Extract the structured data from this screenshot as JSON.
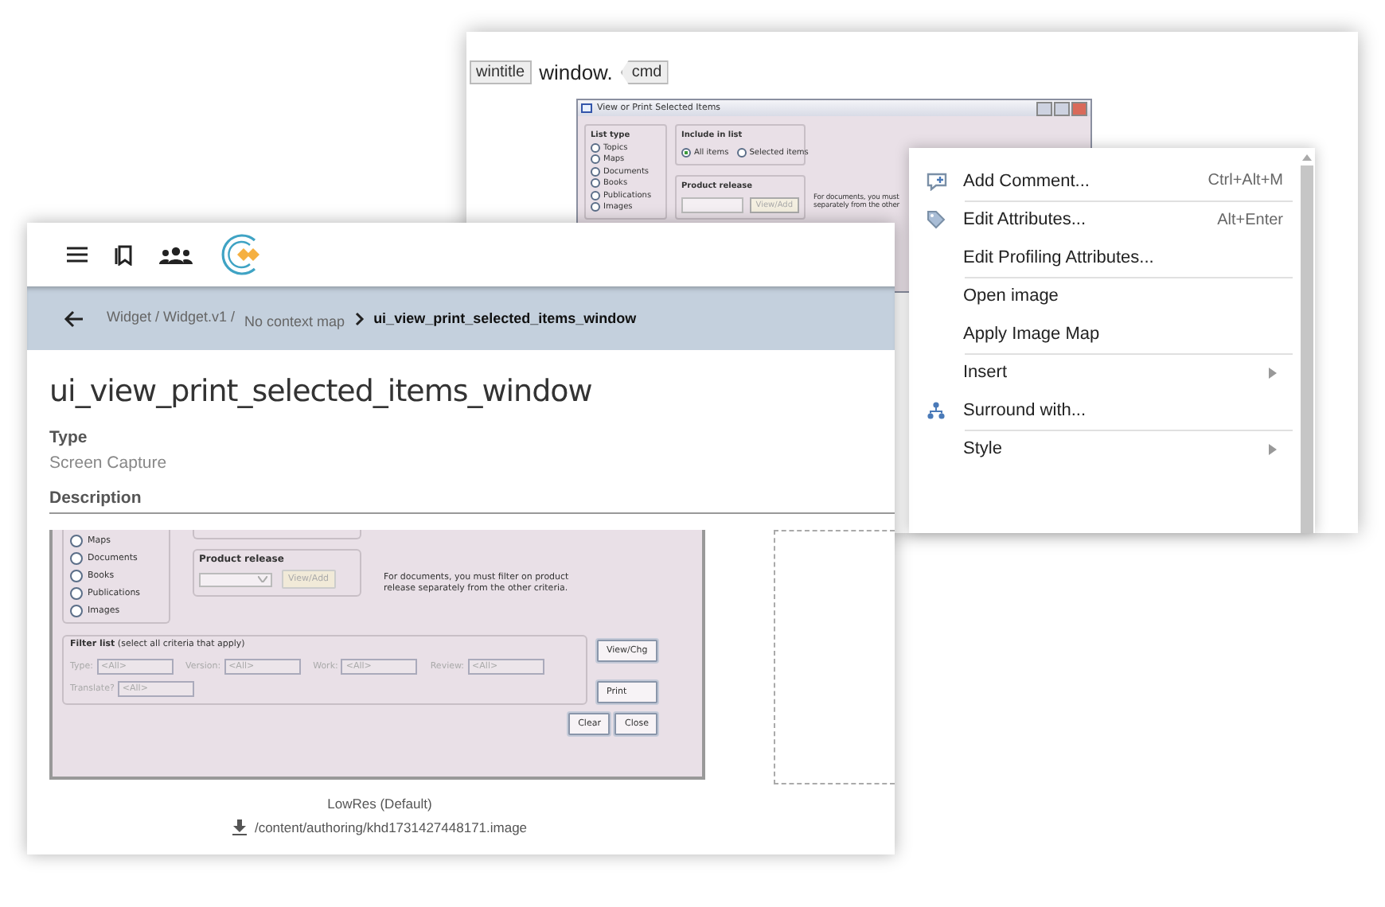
{
  "back_panel": {
    "tag_line": [
      {
        "kind": "tag",
        "text": "wintitle"
      },
      {
        "kind": "word",
        "text": "window."
      },
      {
        "kind": "cmd",
        "text": "cmd"
      }
    ],
    "dialog": {
      "title": "View or Print Selected Items",
      "list_type": {
        "label": "List type",
        "options": [
          {
            "label": "Topics",
            "selected": false
          },
          {
            "label": "Maps",
            "selected": false
          },
          {
            "label": "Documents",
            "selected": false
          },
          {
            "label": "Books",
            "selected": false
          },
          {
            "label": "Publications",
            "selected": false
          },
          {
            "label": "Images",
            "selected": false
          }
        ]
      },
      "include": {
        "label": "Include in list",
        "options": [
          {
            "label": "All items",
            "selected": true
          },
          {
            "label": "Selected items",
            "selected": false
          }
        ]
      },
      "product_release": {
        "label": "Product release",
        "button": {
          "label": "View/Add",
          "disabled": true
        }
      },
      "note": [
        "For documents, you must",
        "separately from the other"
      ]
    }
  },
  "context_menu": {
    "groups": [
      [
        {
          "kind": "comment",
          "label": "Add Comment...",
          "shortcut": "Ctrl+Alt+M",
          "submenu": false
        }
      ],
      [
        {
          "kind": "attributes",
          "label": "Edit Attributes...",
          "shortcut": "Alt+Enter",
          "submenu": false
        },
        {
          "kind": "plain",
          "label": "Edit Profiling Attributes...",
          "submenu": false
        }
      ],
      [
        {
          "kind": "plain",
          "label": "Open image",
          "submenu": false
        },
        {
          "kind": "plain",
          "label": "Apply Image Map",
          "submenu": false
        }
      ],
      [
        {
          "kind": "plain",
          "label": "Insert",
          "submenu": true
        },
        {
          "kind": "surround",
          "label": "Surround with...",
          "submenu": false
        }
      ],
      [
        {
          "kind": "plain",
          "label": "Style",
          "submenu": true
        }
      ]
    ]
  },
  "front_card": {
    "breadcrumb": {
      "path": [
        "Widget / Widget.v1 /",
        "No context map"
      ],
      "current": "ui_view_print_selected_items_window"
    },
    "title": "ui_view_print_selected_items_window",
    "fields": [
      {
        "label": "Type",
        "value": "Screen Capture"
      },
      {
        "label": "Description"
      }
    ],
    "image": {
      "list_type": {
        "options": [
          {
            "label": "Maps",
            "selected": false
          },
          {
            "label": "Documents",
            "selected": false
          },
          {
            "label": "Books",
            "selected": false
          },
          {
            "label": "Publications",
            "selected": false
          },
          {
            "label": "Images",
            "selected": false
          }
        ]
      },
      "product_release": {
        "label": "Product release",
        "button": {
          "label": "View/Add",
          "disabled": true
        }
      },
      "note": "For documents, you must filter on product release separately from the other criteria.",
      "filter_list": {
        "heading": "**Filter list** (select all criteria that apply)",
        "disabled": true,
        "filters": [
          {
            "label": "Type:",
            "value": "<All>"
          },
          {
            "label": "Version:",
            "value": "<All>"
          },
          {
            "label": "Work:",
            "value": "<All>"
          },
          {
            "label": "Review:",
            "value": "<All>"
          },
          {
            "label": "Translate?",
            "value": "<All>"
          }
        ]
      },
      "side_buttons": [
        "View/Chg",
        "Print"
      ],
      "bottom_buttons": [
        "Clear",
        "Close"
      ]
    },
    "caption": "LowRes (Default)",
    "file_path": "/content/authoring/khd1731427448171.image"
  }
}
